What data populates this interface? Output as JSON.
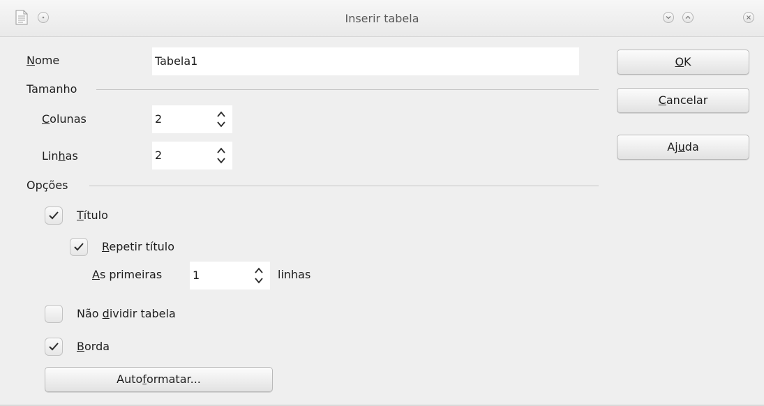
{
  "window": {
    "title": "Inserir tabela",
    "icon": "document-icon"
  },
  "name_field": {
    "label_access": "N",
    "label_rest": "ome",
    "value": "Tabela1"
  },
  "size_section": {
    "title": "Tamanho",
    "columns": {
      "label_access": "C",
      "label_rest": "olunas",
      "value": "2"
    },
    "rows": {
      "label_pre": "Lin",
      "label_access": "h",
      "label_rest": "as",
      "value": "2"
    }
  },
  "options_section": {
    "title": "Opções",
    "heading": {
      "label_access": "T",
      "label_rest": "ítulo",
      "checked": true
    },
    "repeat_heading": {
      "label_access": "R",
      "label_rest": "epetir título",
      "checked": true
    },
    "first_rows": {
      "label_access": "A",
      "label_rest": "s primeiras",
      "value": "1",
      "suffix": "linhas"
    },
    "dont_split": {
      "label_pre": "Não ",
      "label_access": "d",
      "label_rest": "ividir tabela",
      "checked": false
    },
    "border": {
      "label_access": "B",
      "label_rest": "orda",
      "checked": true
    }
  },
  "buttons": {
    "ok": {
      "label_access": "O",
      "label_rest": "K"
    },
    "cancel": {
      "label_access": "C",
      "label_rest": "ancelar"
    },
    "help": {
      "label_pre": "Aj",
      "label_access": "u",
      "label_rest": "da"
    },
    "autoformat": {
      "label_pre": "Auto",
      "label_access": "f",
      "label_rest": "ormatar..."
    }
  }
}
